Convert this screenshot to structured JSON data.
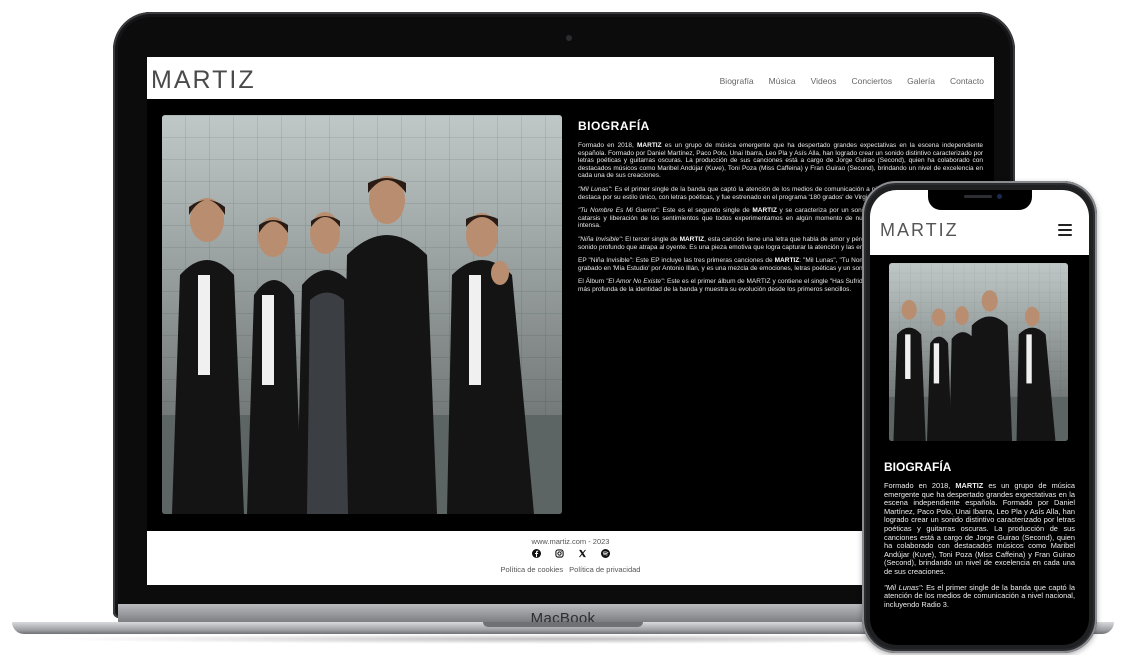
{
  "site": {
    "logo": "MARTIZ",
    "nav": [
      "Biografía",
      "Música",
      "Videos",
      "Conciertos",
      "Galería",
      "Contacto"
    ]
  },
  "bio": {
    "heading": "BIOGRAFÍA",
    "p1": {
      "pre": "Formado en 2018, ",
      "bold": "MARTIZ",
      "post": " es un grupo de música emergente que ha despertado grandes expectativas en la escena independiente española. Formado por Daniel Martínez, Paco Polo, Unai Ibarra, Leo Pla y Asís Alla, han logrado crear un sonido distintivo caracterizado por letras poéticas y guitarras oscuras. La producción de sus canciones está a cargo de Jorge Guirao (Second), quien ha colaborado con destacados músicos como Maribel Andújar (Kuve), Toni Poza (Miss Caffeina) y Fran Guirao (Second), brindando un nivel de excelencia en cada una de sus creaciones."
    },
    "p2": {
      "title": "\"Mil Lunas\"",
      "text": ": Es el primer single de la banda que captó la atención de los medios de comunicación a nivel nacional, incluyendo Radio 3. Se destaca por su estilo único, con letras poéticas, y fue estrenado en el programa '180 grados' de Virginia Díaz."
    },
    "p3": {
      "title": "\"Tu Nombre Es Mi Guerra\"",
      "pre": ": Este es el segundo single de ",
      "bold": "MARTIZ",
      "post": " y se caracteriza por un sonido enérgico. La canción sirve como una catarsis y liberación de los sentimientos que todos experimentamos en algún momento de nuestras vidas. Es una canción emotiva e intensa."
    },
    "p4": {
      "title": "\"Niña Invisible\"",
      "pre": ": El tercer single de ",
      "bold": "MARTIZ",
      "post": ", esta canción tiene una letra que habla de amor y pérdida. Los sentimientos se fusionan con un sonido profundo que atrapa al oyente. Es una pieza emotiva que logra capturar la atención y las emociones."
    },
    "p5": {
      "pre": "EP \"Niña Invisible\": Este EP incluye las tres primeras canciones de ",
      "bold": "MARTIZ",
      "post": ": \"Mil Lunas\", \"Tu Nombre Es Mi Guerra\" y \"Niña Invisible\". Fue grabado en 'Mía Estudio' por Antonio Illán, y es una mezcla de emociones, letras poéticas y un sonido distintivo."
    },
    "p6": {
      "pre": "El Álbum ",
      "title": "\"El Amor No Existe\"",
      "post": ": Este es el primer álbum de MARTIZ y contiene el single \"Has Sufrido Tanto\". El álbum ofrece una exploración más profunda de la identidad de la banda y muestra su evolución desde los primeros sencillos."
    }
  },
  "footer": {
    "domain": "www.martiz.com - 2023",
    "cookies": "Política de cookies",
    "privacy": "Política de privacidad"
  },
  "device": {
    "label": "MacBook"
  },
  "mobile": {
    "logo": "MARTIZ",
    "heading": "BIOGRAFÍA",
    "p1": {
      "pre": "Formado en 2018, ",
      "bold": "MARTIZ",
      "post": " es un grupo de música emergente que ha despertado grandes expectativas en la escena independiente española. Formado por Daniel Martínez, Paco Polo, Unai Ibarra, Leo Pla y Asís Alla, han logrado crear un sonido distintivo caracterizado por letras poéticas y guitarras oscuras. La producción de sus canciones está a cargo de Jorge Guirao (Second), quien ha colaborado con destacados músicos como Maribel Andújar (Kuve), Toni Poza (Miss Caffeina) y Fran Guirao (Second), brindando un nivel de excelencia en cada una de sus creaciones."
    },
    "p2": {
      "title": "\"Mil Lunas\"",
      "text": ": Es el primer single de la banda que captó la atención de los medios de comunicación a nivel nacional, incluyendo Radio 3."
    }
  },
  "colors": {
    "page_bg": "#000000",
    "header_bg": "#ffffff",
    "text": "#ffffff",
    "nav_text": "#666666"
  }
}
